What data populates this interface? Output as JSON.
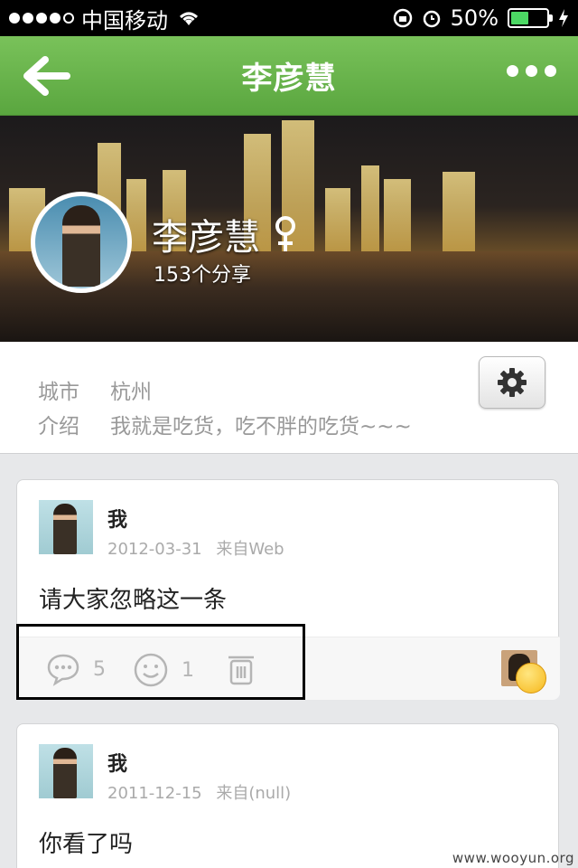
{
  "status_bar": {
    "carrier": "中国移动",
    "battery_percent": "50%",
    "battery_level": 0.5,
    "signal_bars": 4
  },
  "navbar": {
    "title": "李彦慧",
    "back_icon": "back-arrow-icon",
    "more_icon": "more-dots-icon"
  },
  "profile": {
    "name": "李彦慧",
    "gender_icon": "female-icon",
    "share_count": "153个分享"
  },
  "info": {
    "city_label": "城市",
    "city_value": "杭州",
    "intro_label": "介绍",
    "intro_value": "我就是吃货，吃不胖的吃货~~~",
    "settings_icon": "gear-icon"
  },
  "posts": [
    {
      "author": "我",
      "date": "2012-03-31",
      "source": "来自Web",
      "content": "请大家忽略这一条",
      "comment_count": "5",
      "like_count": "1"
    },
    {
      "author": "我",
      "date": "2011-12-15",
      "source": "来自(null)",
      "content": "你看了吗"
    }
  ],
  "watermark": "www.wooyun.org",
  "colors": {
    "nav_green": "#5aa63f",
    "battery_green": "#4cd964",
    "icon_gray": "#b5b5b5"
  }
}
